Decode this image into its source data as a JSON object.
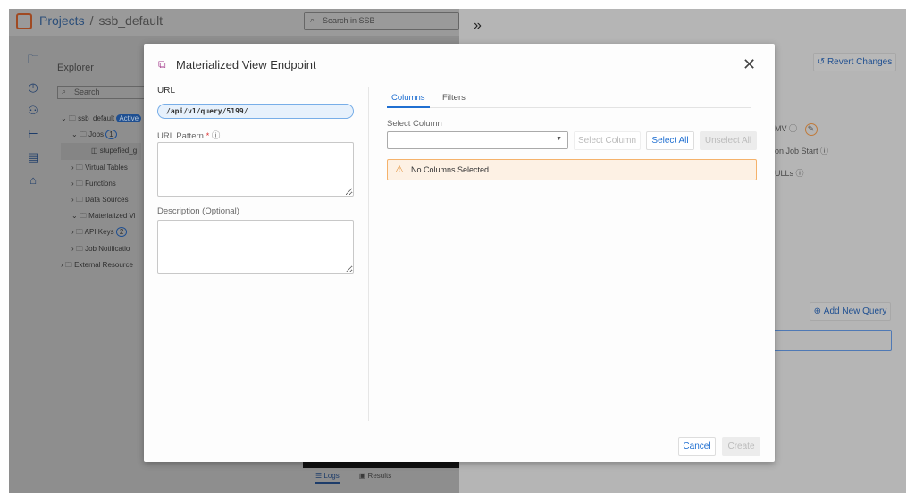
{
  "header": {
    "breadcrumb_root": "Projects",
    "breadcrumb_sep": "/",
    "breadcrumb_current": "ssb_default",
    "search_placeholder": "Search in SSB"
  },
  "explorer": {
    "title": "Explorer",
    "search_placeholder": "Search",
    "tree": [
      {
        "label": "ssb_default",
        "badge": "Active"
      },
      {
        "label": "Jobs",
        "count": "1"
      },
      {
        "label": "stupefied_g"
      },
      {
        "label": "Virtual Tables"
      },
      {
        "label": "Functions"
      },
      {
        "label": "Data Sources"
      },
      {
        "label": "Materialized Vi"
      },
      {
        "label": "API Keys",
        "count": "2"
      },
      {
        "label": "Job Notificatio"
      },
      {
        "label": "External Resource"
      }
    ]
  },
  "right_panel": {
    "collapse": "»",
    "revert": "Revert Changes",
    "mv_label": "MV",
    "job_start": "on Job Start",
    "nulls": "ULLs",
    "add_query": "Add New Query"
  },
  "bottom_tabs": {
    "logs": "Logs",
    "results": "Results"
  },
  "modal": {
    "title": "Materialized View Endpoint",
    "url_label": "URL",
    "url_value": "/api/v1/query/5199/",
    "url_pattern_label": "URL Pattern",
    "required_mark": "*",
    "description_label": "Description (Optional)",
    "tabs": [
      "Columns",
      "Filters"
    ],
    "select_column_label": "Select Column",
    "select_column_btn": "Select Column",
    "select_all": "Select All",
    "unselect_all": "Unselect All",
    "warning": "No Columns Selected",
    "cancel": "Cancel",
    "create": "Create"
  },
  "colors": {
    "accent": "#1f6fd1",
    "warning_bg": "#fdf1e4",
    "warning_border": "#f5b26b",
    "brand": "#e0622a"
  }
}
